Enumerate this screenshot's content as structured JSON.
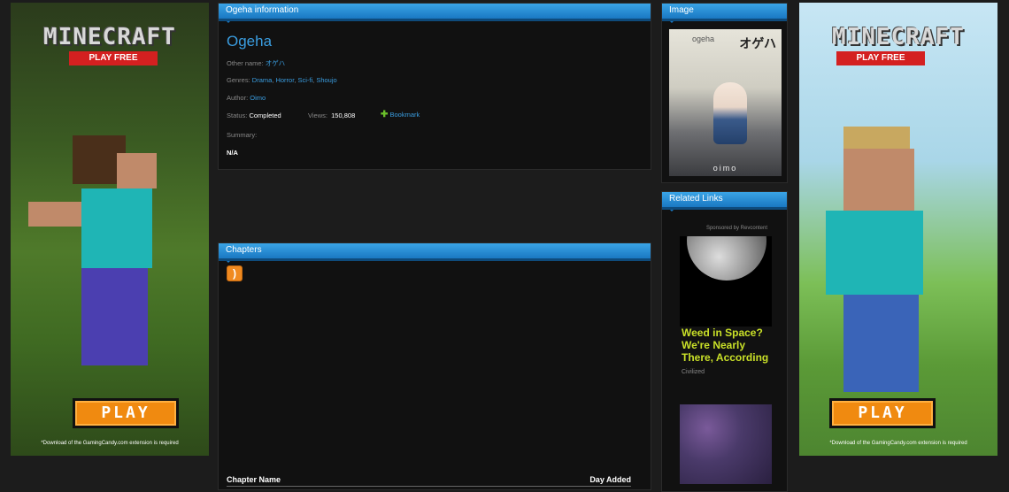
{
  "ad_left": {
    "logo": "MINECRAFT",
    "tagline": "PLAY FREE",
    "play": "PLAY",
    "note": "*Download of the GamingCandy.com extension is required"
  },
  "ad_right": {
    "logo": "MINECRAFT",
    "tagline": "PLAY FREE",
    "play": "PLAY",
    "note": "*Download of the GamingCandy.com extension is required"
  },
  "info": {
    "header": "Ogeha information",
    "title": "Ogeha",
    "other_name_label": "Other name:",
    "other_name": "オゲハ",
    "genres_label": "Genres:",
    "genres": [
      "Drama",
      "Horror",
      "Sci-fi",
      "Shoujo"
    ],
    "author_label": "Author:",
    "author": "Oimo",
    "status_label": "Status:",
    "status": "Completed",
    "views_label": "Views:",
    "views": "150,808",
    "bookmark": "Bookmark",
    "summary_label": "Summary:",
    "summary": "N/A"
  },
  "image_panel": {
    "header": "Image",
    "cover_title": "オゲハ",
    "cover_vertical": "ogeha",
    "cover_author": "oimo"
  },
  "chapters": {
    "header": "Chapters",
    "col_name": "Chapter Name",
    "col_date": "Day Added"
  },
  "related": {
    "header": "Related Links",
    "sponsored": "Sponsored by Revcontent",
    "headline": "Weed in Space? We're Nearly There, According",
    "source": "Civilized"
  },
  "colors": {
    "accent": "#3a9de0",
    "header_blue": "#1a78c2",
    "ad_headline": "#c9e028"
  }
}
